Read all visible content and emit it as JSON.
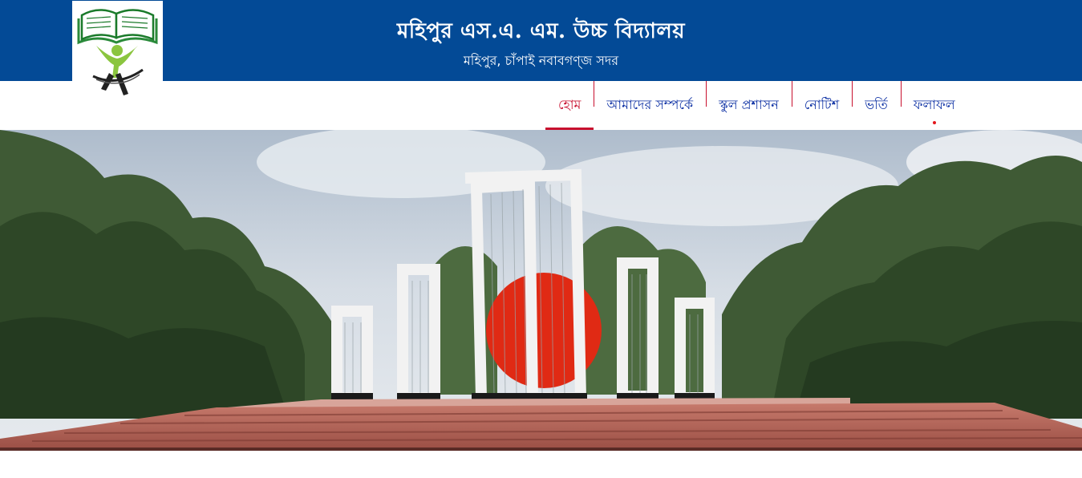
{
  "header": {
    "school_name": "মহিপুর এস.এ. এম. উচ্চ বিদ্যালয়",
    "address": "মহিপুর, চাঁপাই নবাবগণ্জ সদর",
    "logo_icon": "school-book-student-logo",
    "background_color": "#034a96"
  },
  "nav": {
    "items": [
      {
        "label": "হোম",
        "active": true
      },
      {
        "label": "আমাদের সম্পর্কে",
        "active": false
      },
      {
        "label": "স্কুল প্রশাসন",
        "active": false
      },
      {
        "label": "নোটিশ",
        "active": false
      },
      {
        "label": "ভর্তি",
        "active": false
      },
      {
        "label": "ফলাফল",
        "active": false
      }
    ],
    "active_color": "#c8102e",
    "link_color": "#0b2fa3"
  },
  "hero": {
    "image_subject": "shaheed-minar-monument-photo"
  }
}
